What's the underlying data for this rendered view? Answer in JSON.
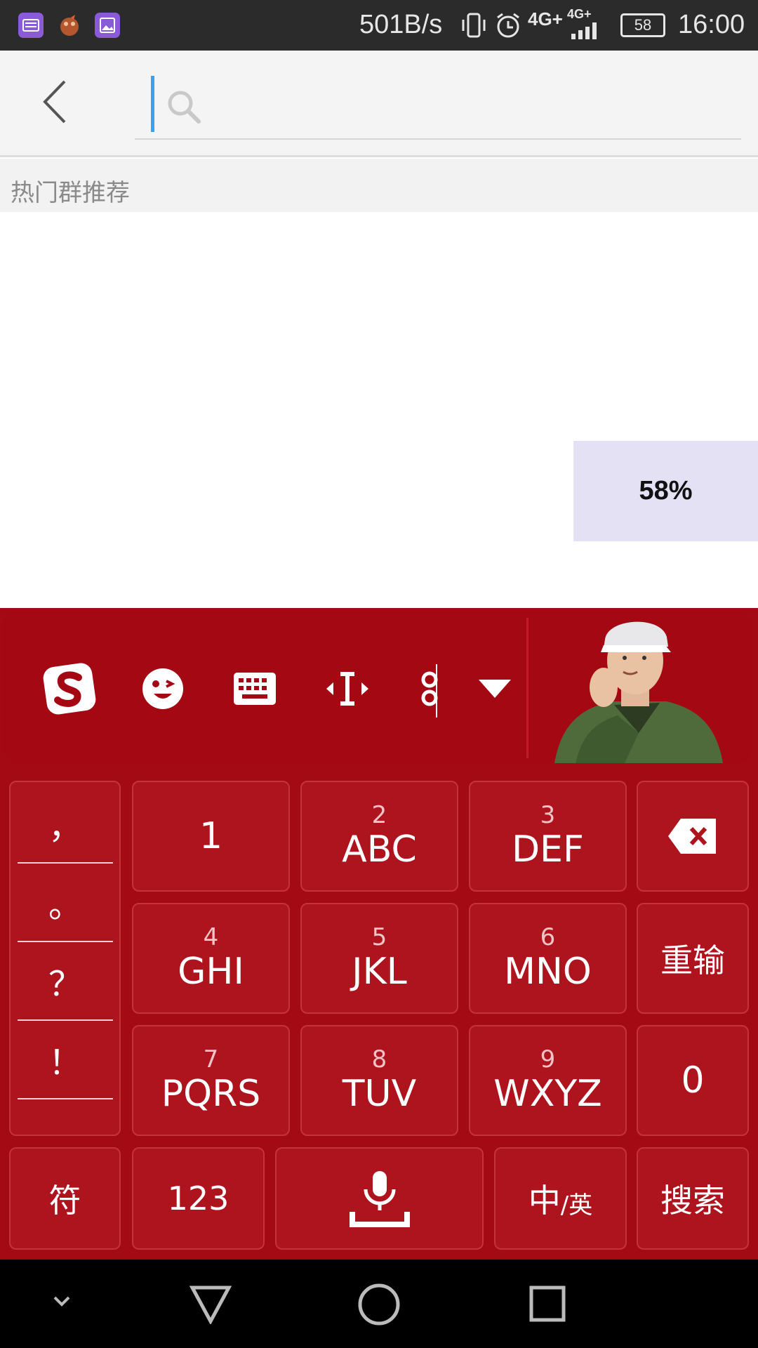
{
  "status_bar": {
    "net_speed": "501B/s",
    "signal_label": "4G+",
    "signal_label_2": "4G+",
    "battery": "58",
    "time": "16:00",
    "app_icon_colors": [
      "#8a5bd6",
      "#c86a3a",
      "#8a5bd6"
    ]
  },
  "search": {
    "placeholder": "",
    "value": ""
  },
  "section": {
    "title": "热门群推荐"
  },
  "battery_popup": {
    "text": "58%"
  },
  "keyboard": {
    "toolbar_icons": [
      "sogou-logo-icon",
      "emoji-icon",
      "keyboard-icon",
      "cursor-move-icon",
      "clipboard-icon",
      "collapse-icon"
    ],
    "punctuation": [
      "，",
      "。",
      "？",
      "！"
    ],
    "rows": [
      [
        {
          "num": "",
          "label": "1"
        },
        {
          "num": "2",
          "label": "ABC"
        },
        {
          "num": "3",
          "label": "DEF"
        }
      ],
      [
        {
          "num": "4",
          "label": "GHI"
        },
        {
          "num": "5",
          "label": "JKL"
        },
        {
          "num": "6",
          "label": "MNO"
        }
      ],
      [
        {
          "num": "7",
          "label": "PQRS"
        },
        {
          "num": "8",
          "label": "TUV"
        },
        {
          "num": "9",
          "label": "WXYZ"
        }
      ]
    ],
    "reinput": "重输",
    "zero": "0",
    "symbols": "符",
    "numbers": "123",
    "lang_main": "中",
    "lang_sub": "/英",
    "search": "搜索",
    "colors": {
      "background": "#a30a14",
      "key": "#ad141e",
      "key_border": "#c5323b"
    }
  },
  "nav_bar": {
    "icons": [
      "collapse-chevron-icon",
      "back-triangle-icon",
      "home-circle-icon",
      "recents-square-icon"
    ]
  }
}
